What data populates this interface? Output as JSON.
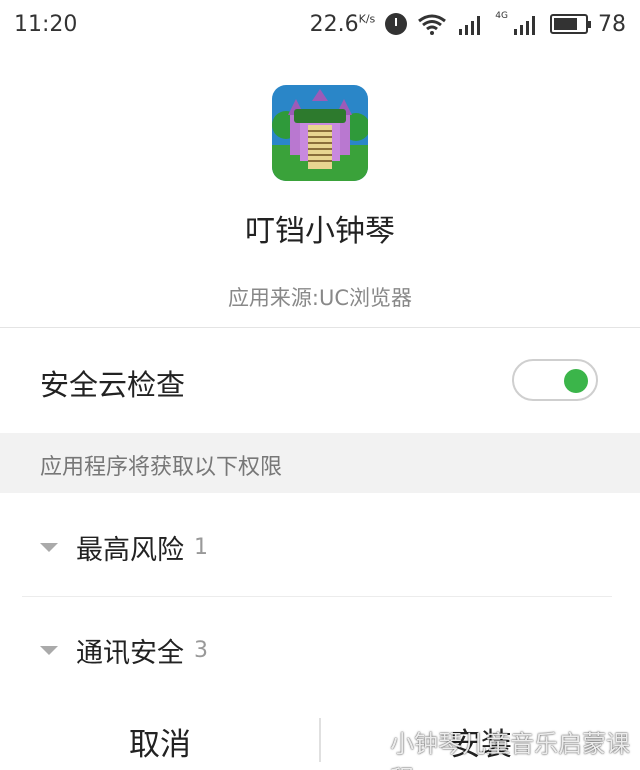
{
  "status_bar": {
    "time": "11:20",
    "net_speed": "22.6",
    "net_unit": "K/s",
    "network_type": "4G",
    "battery": "78"
  },
  "app": {
    "icon": "piano-game-castle-icon",
    "name": "叮铛小钟琴",
    "source": "应用来源:UC浏览器"
  },
  "security_check": {
    "label": "安全云检查",
    "enabled": true,
    "accent_color": "#3bb54a"
  },
  "permissions": {
    "header": "应用程序将获取以下权限",
    "items": [
      {
        "label": "最高风险",
        "count": "1"
      },
      {
        "label": "通讯安全",
        "count": "3"
      }
    ]
  },
  "buttons": {
    "cancel": "取消",
    "install": "安装"
  },
  "watermark": {
    "text": "小钟琴儿童音乐启蒙课程",
    "icon": "wechat-icon"
  }
}
